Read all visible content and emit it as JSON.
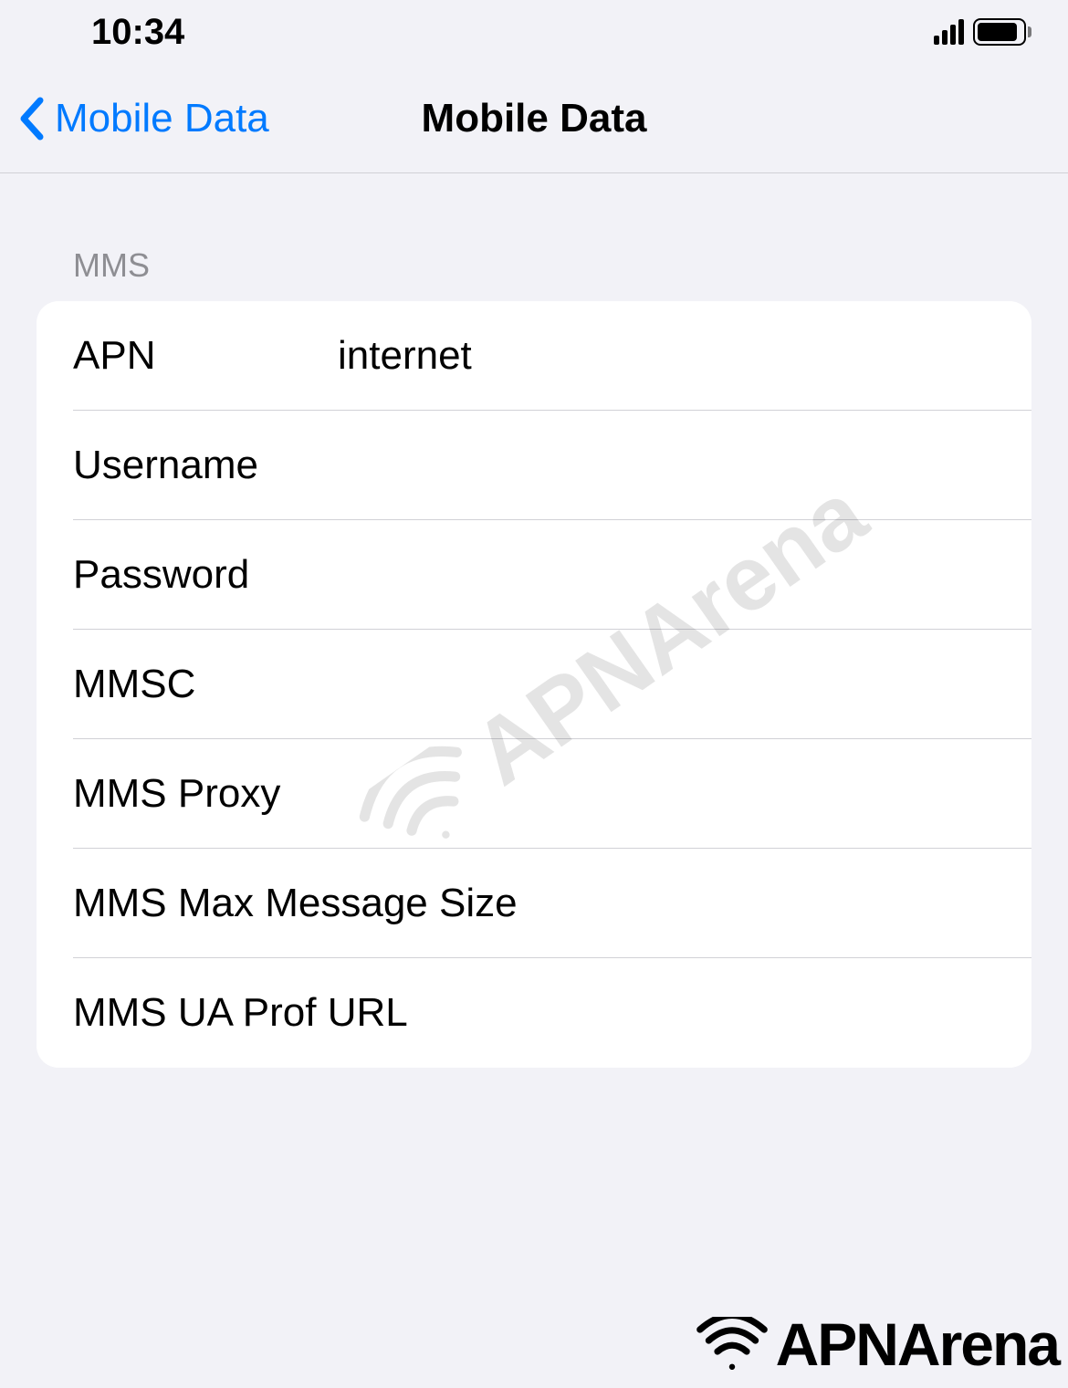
{
  "statusBar": {
    "time": "10:34"
  },
  "navHeader": {
    "backLabel": "Mobile Data",
    "title": "Mobile Data"
  },
  "section": {
    "header": "MMS"
  },
  "fields": {
    "apn": {
      "label": "APN",
      "value": "internet"
    },
    "username": {
      "label": "Username",
      "value": ""
    },
    "password": {
      "label": "Password",
      "value": ""
    },
    "mmsc": {
      "label": "MMSC",
      "value": ""
    },
    "mmsProxy": {
      "label": "MMS Proxy",
      "value": ""
    },
    "mmsMaxSize": {
      "label": "MMS Max Message Size",
      "value": ""
    },
    "mmsUaProf": {
      "label": "MMS UA Prof URL",
      "value": ""
    }
  },
  "watermark": {
    "text": "APNArena"
  }
}
